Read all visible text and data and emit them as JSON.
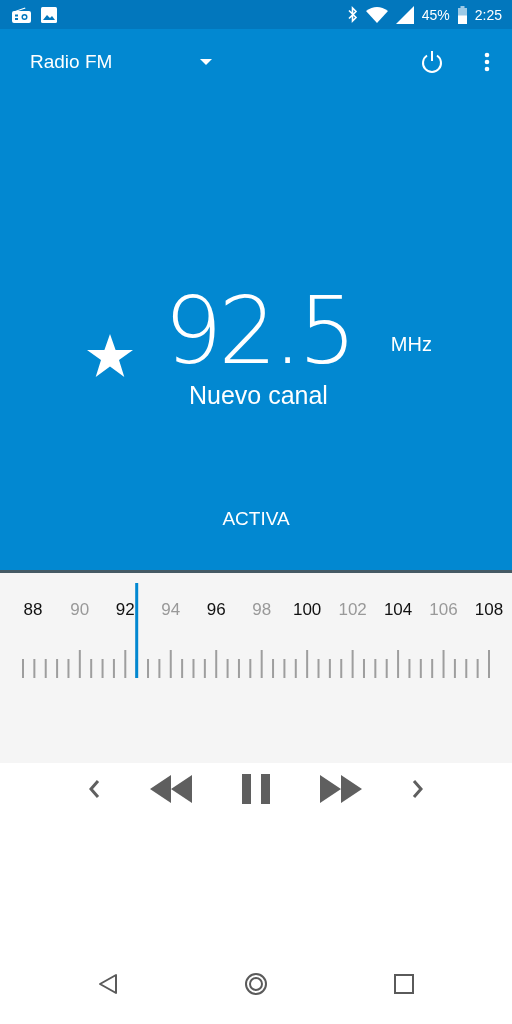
{
  "status_bar": {
    "battery": "45%",
    "time": "2:25"
  },
  "app_bar": {
    "title": "Radio FM"
  },
  "station": {
    "favorite": true,
    "frequency": "92.5",
    "unit": "MHz",
    "name": "Nuevo canal"
  },
  "state_label": "ACTIVA",
  "tuner": {
    "level": 0.244,
    "labels": [
      {
        "text": "88",
        "dim": false
      },
      {
        "text": "90",
        "dim": true
      },
      {
        "text": "92",
        "dim": false
      },
      {
        "text": "94",
        "dim": true
      },
      {
        "text": "96",
        "dim": false
      },
      {
        "text": "98",
        "dim": true
      },
      {
        "text": "100",
        "dim": false
      },
      {
        "text": "102",
        "dim": true
      },
      {
        "text": "104",
        "dim": false
      },
      {
        "text": "106",
        "dim": true
      },
      {
        "text": "108",
        "dim": false
      }
    ]
  }
}
